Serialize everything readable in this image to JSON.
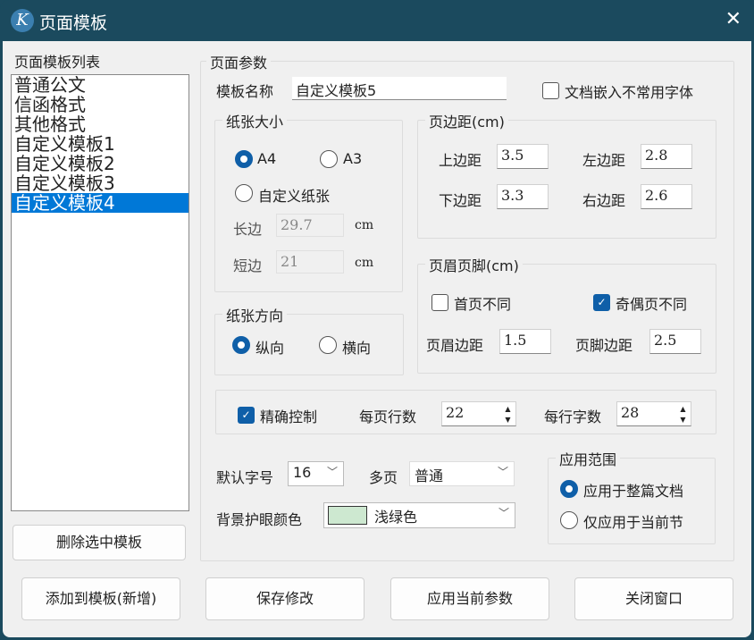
{
  "window": {
    "title": "页面模板",
    "logo": "K",
    "close": "✕"
  },
  "templates": {
    "label": "页面模板列表",
    "items": [
      "普通公文",
      "信函格式",
      "其他格式",
      "自定义模板1",
      "自定义模板2",
      "自定义模板3",
      "自定义模板4"
    ],
    "selected": 6,
    "delete": "删除选中模板"
  },
  "params": {
    "legend": "页面参数",
    "name_label": "模板名称",
    "name_value": "自定义模板5",
    "embed_fonts": "文档嵌入不常用字体",
    "paper": {
      "legend": "纸张大小",
      "a4": "A4",
      "a3": "A3",
      "custom": "自定义纸张",
      "long_label": "长边",
      "long_value": "29.7",
      "short_label": "短边",
      "short_value": "21",
      "unit": "cm"
    },
    "orient": {
      "legend": "纸张方向",
      "portrait": "纵向",
      "landscape": "横向"
    },
    "margins": {
      "legend": "页边距(cm)",
      "top_label": "上边距",
      "top": "3.5",
      "left_label": "左边距",
      "left": "2.8",
      "bottom_label": "下边距",
      "bottom": "3.3",
      "right_label": "右边距",
      "right": "2.6"
    },
    "hf": {
      "legend": "页眉页脚(cm)",
      "first_diff": "首页不同",
      "odd_even": "奇偶页不同",
      "header_label": "页眉边距",
      "header": "1.5",
      "footer_label": "页脚边距",
      "footer": "2.5"
    },
    "precise": {
      "label": "精确控制",
      "lines_label": "每页行数",
      "lines": "22",
      "chars_label": "每行字数",
      "chars": "28"
    },
    "font_size_label": "默认字号",
    "font_size": "16",
    "multipage_label": "多页",
    "multipage": "普通",
    "bg_label": "背景护眼颜色",
    "bg_value": "浅绿色",
    "bg_color": "#cde8d0",
    "scope": {
      "legend": "应用范围",
      "whole": "应用于整篇文档",
      "section": "仅应用于当前节"
    }
  },
  "buttons": {
    "add": "添加到模板(新增)",
    "save": "保存修改",
    "apply": "应用当前参数",
    "close": "关闭窗口"
  }
}
